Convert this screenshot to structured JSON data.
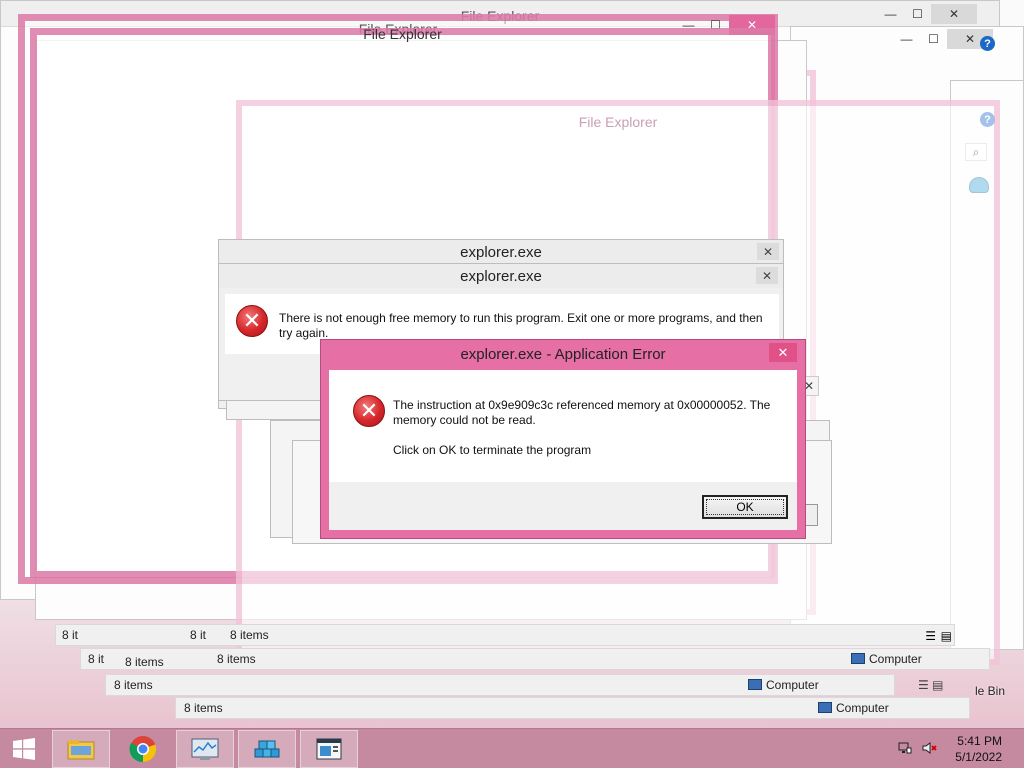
{
  "windows": {
    "explorer_title": "File Explorer",
    "items_count": "8 items",
    "items_count_truncated": "8 it",
    "computer_label": "Computer",
    "recycle_bin_label": "le Bin"
  },
  "dialogs": {
    "memory": {
      "title": "explorer.exe",
      "message": "There is not enough free memory to run this program. Exit one or more programs, and then try again."
    },
    "app_error": {
      "title": "explorer.exe - Application Error",
      "message_line1": "The instruction at 0x9e909c3c referenced memory at 0x00000052. The memory could not be read.",
      "message_line2": "Click on OK to terminate the program",
      "ok_label": "OK"
    }
  },
  "taskbar": {
    "items": [
      "file-explorer",
      "chrome",
      "resource-monitor",
      "registry-editor",
      "command-window"
    ],
    "clock": {
      "time": "5:41 PM",
      "date": "5/1/2022"
    }
  },
  "colors": {
    "accent_pink": "#e66fa6",
    "error_red": "#d6262a",
    "taskbar": "#c58aa0"
  }
}
